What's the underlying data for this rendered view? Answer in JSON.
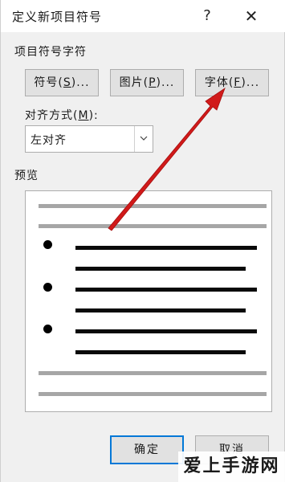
{
  "dialog": {
    "title": "定义新项目符号",
    "help_label": "?",
    "close_label": "✕"
  },
  "bullet_section": {
    "label": "项目符号字符",
    "symbol_button": {
      "text": "符号(",
      "mnemonic": "S",
      "suffix": ")..."
    },
    "picture_button": {
      "text": "图片(",
      "mnemonic": "P",
      "suffix": ")..."
    },
    "font_button": {
      "text": "字体(",
      "mnemonic": "F",
      "suffix": ")..."
    }
  },
  "alignment": {
    "label_text": "对齐方式(",
    "label_mnemonic": "M",
    "label_suffix": "):",
    "selected_value": "左对齐"
  },
  "preview": {
    "label": "预览"
  },
  "footer": {
    "ok_label": "确定",
    "cancel_label": "取消"
  },
  "watermark": {
    "text": "爱上手游网"
  },
  "colors": {
    "annotation_arrow": "#d11a1a",
    "default_button_border": "#0078d7"
  }
}
